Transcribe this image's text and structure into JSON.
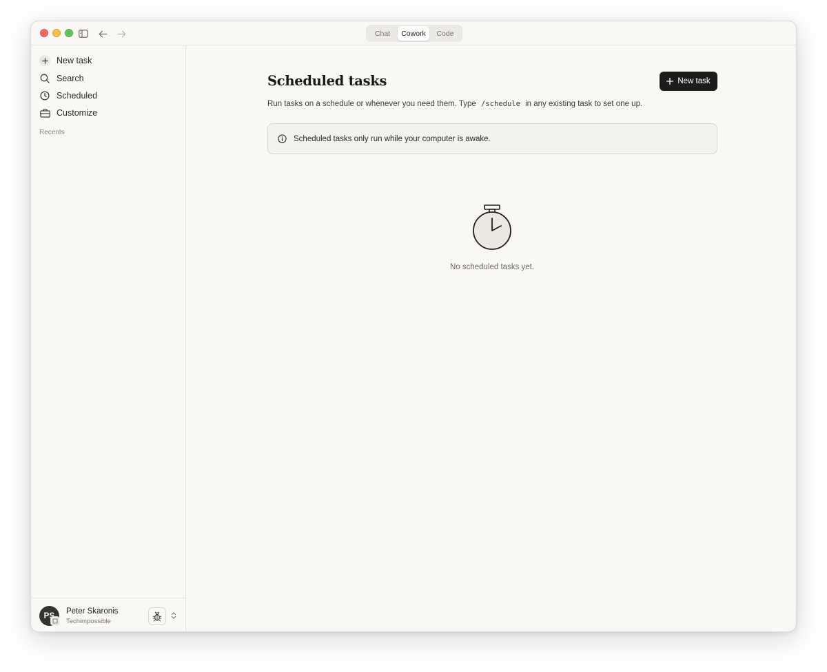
{
  "titlebar": {
    "tabs": [
      {
        "label": "Chat",
        "active": false
      },
      {
        "label": "Cowork",
        "active": true
      },
      {
        "label": "Code",
        "active": false
      }
    ]
  },
  "sidebar": {
    "items": [
      {
        "label": "New task",
        "icon": "plus-icon"
      },
      {
        "label": "Search",
        "icon": "search-icon"
      },
      {
        "label": "Scheduled",
        "icon": "clock-icon"
      },
      {
        "label": "Customize",
        "icon": "briefcase-icon"
      }
    ],
    "recents_label": "Recents"
  },
  "user": {
    "initials": "PS",
    "name": "Peter Skaronis",
    "org": "Techimpossible"
  },
  "main": {
    "title": "Scheduled tasks",
    "new_task_label": "New task",
    "subtitle_before": "Run tasks on a schedule or whenever you need them. Type",
    "subtitle_code": "/schedule",
    "subtitle_after": "in any existing task to set one up.",
    "notice": "Scheduled tasks only run while your computer is awake.",
    "empty_state": "No scheduled tasks yet."
  },
  "colors": {
    "background": "#f9f8f5",
    "primary_button": "#1d1c1a",
    "notice_bg": "#f3f2ee"
  }
}
